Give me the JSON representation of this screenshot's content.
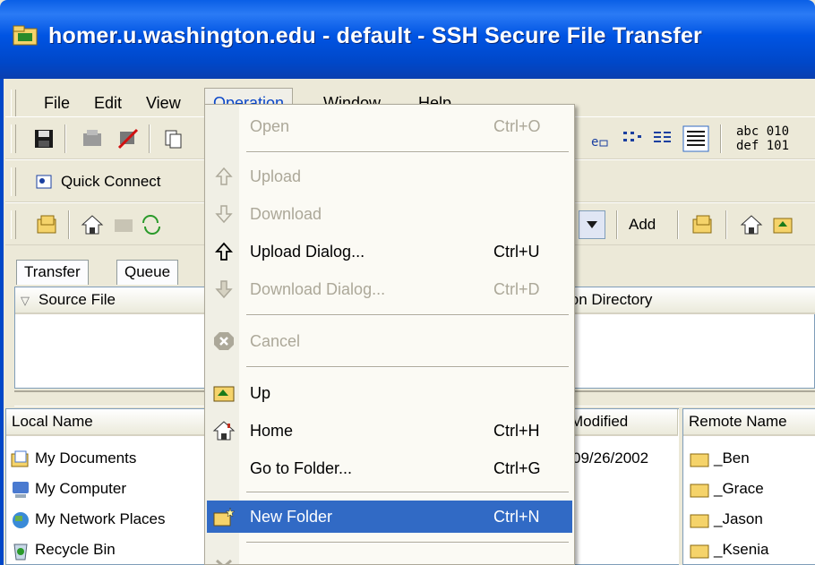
{
  "window": {
    "title": "homer.u.washington.edu - default - SSH Secure File Transfer"
  },
  "menubar": {
    "items": [
      "File",
      "Edit",
      "View",
      "Operation",
      "Window",
      "Help"
    ]
  },
  "toolbar2": {
    "quick_connect": "Quick Connect"
  },
  "toolbar3": {
    "add_label": "Add"
  },
  "toolbar_text": {
    "abc": "abc",
    "def": "def",
    "n1": "010",
    "n2": "101"
  },
  "tabs": [
    "Transfer",
    "Queue"
  ],
  "transfer": {
    "col_source": "Source File",
    "col_dest": "ion Directory"
  },
  "local": {
    "col_name": "Local Name",
    "col_modified": "Modified",
    "items": [
      {
        "name": "My Documents",
        "modified": "09/26/2002"
      },
      {
        "name": "My Computer",
        "modified": ""
      },
      {
        "name": "My Network Places",
        "modified": ""
      },
      {
        "name": "Recycle Bin",
        "modified": ""
      }
    ]
  },
  "remote": {
    "col_name": "Remote Name",
    "items": [
      "_Ben",
      "_Grace",
      "_Jason",
      "_Ksenia"
    ]
  },
  "operation_menu": {
    "open": {
      "label": "Open",
      "shortcut": "Ctrl+O"
    },
    "upload": {
      "label": "Upload"
    },
    "download": {
      "label": "Download"
    },
    "upload_dialog": {
      "label": "Upload Dialog...",
      "shortcut": "Ctrl+U"
    },
    "download_dialog": {
      "label": "Download Dialog...",
      "shortcut": "Ctrl+D"
    },
    "cancel": {
      "label": "Cancel"
    },
    "up": {
      "label": "Up"
    },
    "home": {
      "label": "Home",
      "shortcut": "Ctrl+H"
    },
    "go_to_folder": {
      "label": "Go to Folder...",
      "shortcut": "Ctrl+G"
    },
    "new_folder": {
      "label": "New Folder",
      "shortcut": "Ctrl+N"
    }
  },
  "colors": {
    "titlebar": "#0054e3",
    "highlight": "#316ac5",
    "disabled": "#aca899"
  }
}
